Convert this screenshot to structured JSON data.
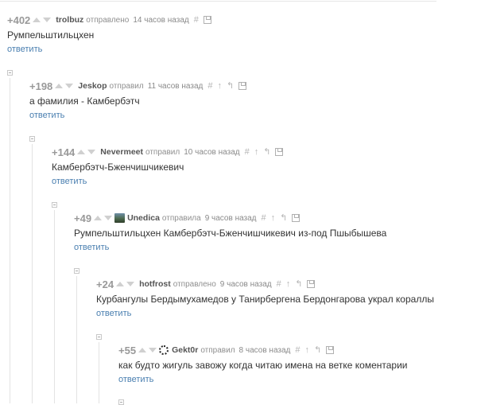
{
  "comments": [
    {
      "rating": "+402",
      "author": "trolbuz",
      "verb": "отправлено",
      "time": "14 часов назад",
      "text": "Румпельштильцхен",
      "reply": "ответить",
      "avatar": "none"
    },
    {
      "rating": "+198",
      "author": "Jeskop",
      "verb": "отправил",
      "time": "11 часов назад",
      "text": "а фамилия - Камбербэтч",
      "reply": "ответить",
      "avatar": "none"
    },
    {
      "rating": "+144",
      "author": "Nevermeet",
      "verb": "отправил",
      "time": "10 часов назад",
      "text": "Камбербэтч-Бженчишчикевич",
      "reply": "ответить",
      "avatar": "none"
    },
    {
      "rating": "+49",
      "author": "Unedica",
      "verb": "отправила",
      "time": "9 часов назад",
      "text": "Румпельштильцхен Камбербэтч-Бженчишчикевич из-под Пшыбышева",
      "reply": "ответить",
      "avatar": "landscape-avatar"
    },
    {
      "rating": "+24",
      "author": "hotfrost",
      "verb": "отправлено",
      "time": "9 часов назад",
      "text": "Курбангулы Бердымухамедов у Танирбергена Бердонгарова украл кораллы",
      "reply": "ответить",
      "avatar": "none"
    },
    {
      "rating": "+55",
      "author": "Gekt0r",
      "verb": "отправил",
      "time": "8 часов назад",
      "text": "как будто жигуль завожу когда читаю имена на ветке коментарии",
      "reply": "ответить",
      "avatar": "ring-avatar"
    }
  ],
  "icons": {
    "hash": "#",
    "up_arrow": "↑",
    "parent_arrow": "↰"
  },
  "colors": {
    "reply_link": "#4a7fb0",
    "rating": "#999999",
    "tree_line": "#e3e3e3"
  }
}
